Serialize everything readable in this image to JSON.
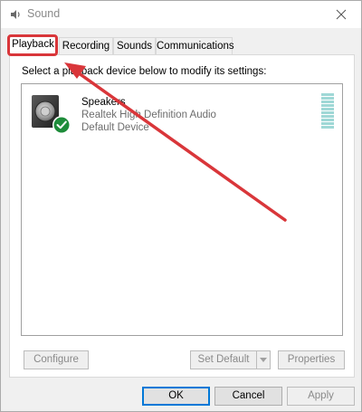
{
  "window": {
    "title": "Sound",
    "close_icon": "close-icon",
    "app_icon": "speaker-app-icon"
  },
  "tabs": [
    {
      "label": "Playback",
      "active": true
    },
    {
      "label": "Recording",
      "active": false
    },
    {
      "label": "Sounds",
      "active": false
    },
    {
      "label": "Communications",
      "active": false
    }
  ],
  "playback": {
    "instruction": "Select a playback device below to modify its settings:",
    "devices": [
      {
        "name": "Speakers",
        "description": "Realtek High Definition Audio",
        "status": "Default Device",
        "icon": "speaker-icon",
        "badge_icon": "check-icon",
        "badge_color": "#1e8c3a",
        "meter_color": "#9fd8d6"
      }
    ],
    "configure_label": "Configure",
    "set_default_label": "Set Default",
    "properties_label": "Properties"
  },
  "footer": {
    "ok_label": "OK",
    "cancel_label": "Cancel",
    "apply_label": "Apply"
  },
  "annotation": {
    "highlight_color": "#d9363a"
  }
}
